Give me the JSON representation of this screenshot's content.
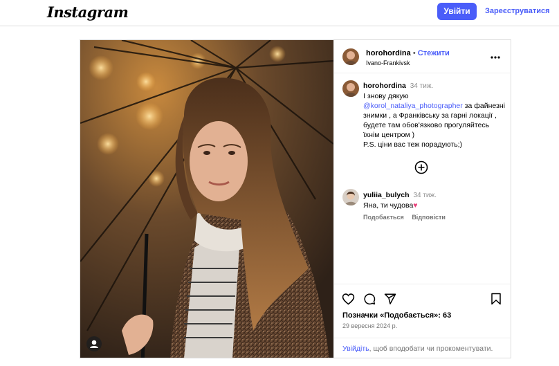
{
  "header": {
    "logo": "Instagram",
    "login_label": "Увійти",
    "signup_label": "Зареєструватися"
  },
  "post": {
    "author": "horohordina",
    "separator": "•",
    "follow_label": "Стежити",
    "location": "Ivano-Frankivsk",
    "more_icon": "more-horizontal-icon",
    "caption": {
      "user": "horohordina",
      "time": "34 тиж.",
      "line1": "І знову дякую",
      "mention": "@korol_nataliya_photographer",
      "line2": " за файнезні знимки , а Франківську за гарні локації , будете там обов'язково прогуляйтесь їхнім центром )",
      "line3": "P.S. ціни вас теж порадують;)"
    },
    "load_more_icon": "plus-circle-icon",
    "comments": [
      {
        "user": "yuliia_bulych",
        "time": "34 тиж.",
        "text": "Яна, ти чудова",
        "emoji": "♥",
        "like_label": "Подобається",
        "reply_label": "Відповісти"
      }
    ],
    "likes_text": "Позначки «Подобається»: 63",
    "date": "29 вересня 2024 р.",
    "footer": {
      "login_link": "Увійдіть",
      "rest": ", щоб вподобати чи прокоментувати."
    }
  },
  "colors": {
    "accent": "#4a5df9",
    "muted": "#737373",
    "border": "#dbdbdb",
    "heart": "#e8417a"
  }
}
